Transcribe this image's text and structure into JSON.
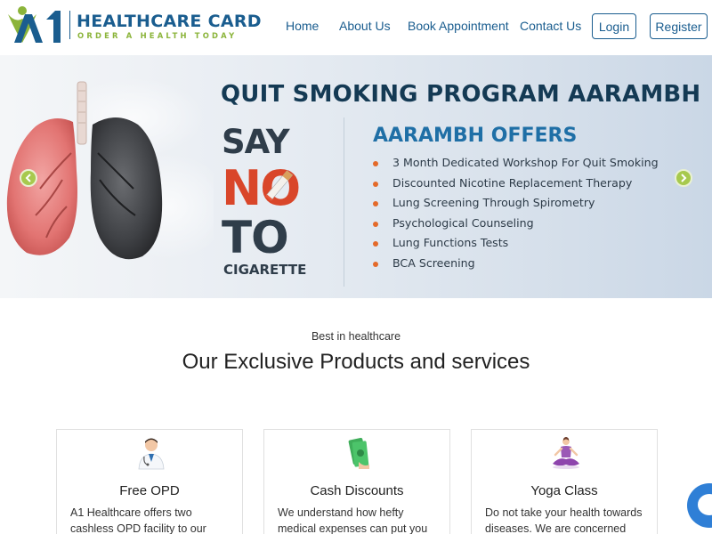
{
  "brand": {
    "title": "HEALTHCARE CARD",
    "tagline": "ORDER A HEALTH TODAY"
  },
  "nav": {
    "links": [
      "Home",
      "About Us",
      "Book Appointment",
      "Contact Us"
    ],
    "login": "Login",
    "register": "Register"
  },
  "banner": {
    "title": "QUIT SMOKING PROGRAM AARAMBH",
    "say": "SAY",
    "no": "NO",
    "to": "TO",
    "cigarette": "CIGARETTE",
    "offers_title": "AARAMBH OFFERS",
    "offers": [
      "3 Month Dedicated Workshop For Quit Smoking",
      "Discounted Nicotine Replacement Therapy",
      "Lung Screening Through Spirometry",
      "Psychological Counseling",
      "Lung Functions Tests",
      "BCA Screening"
    ]
  },
  "section": {
    "kicker": "Best in healthcare",
    "title": "Our Exclusive Products and services"
  },
  "cards": [
    {
      "icon": "doctor-icon",
      "title": "Free OPD",
      "text": "A1 Healthcare offers two cashless OPD facility to our"
    },
    {
      "icon": "cash-icon",
      "title": "Cash Discounts",
      "text": "We understand how hefty medical expenses can put you"
    },
    {
      "icon": "yoga-icon",
      "title": "Yoga Class",
      "text": "Do not take your health towards diseases. We are concerned"
    }
  ],
  "colors": {
    "brand_blue": "#1a5d8f",
    "brand_green": "#8bb43a",
    "accent_orange": "#e46a2a",
    "chat_blue": "#2f7fd6"
  }
}
